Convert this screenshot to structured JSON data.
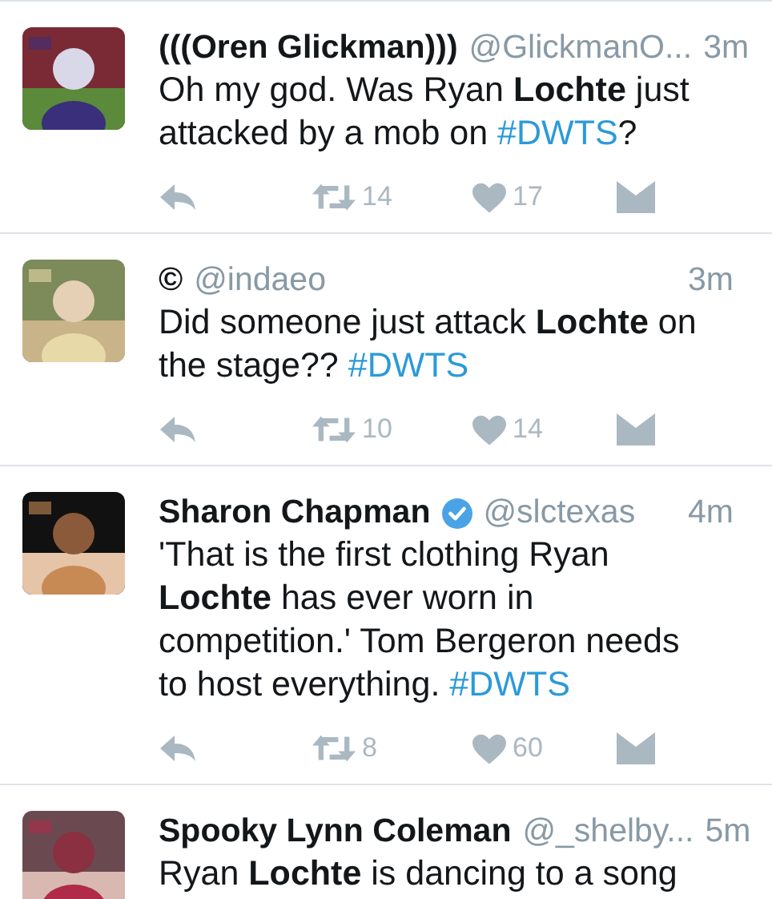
{
  "tweets": [
    {
      "name": "(((Oren Glickman)))",
      "verified": false,
      "handle": "@GlickmanO...",
      "time": "3m",
      "body": [
        {
          "kind": "text",
          "text": "Oh my god. Was Ryan **Lochte** just attacked by a mob on "
        },
        {
          "kind": "hashtag",
          "text": "#DWTS"
        },
        {
          "kind": "text",
          "text": "?"
        }
      ],
      "retweets": "14",
      "likes": "17"
    },
    {
      "name": "©",
      "verified": false,
      "handle": "@indaeo",
      "time": "3m",
      "body": [
        {
          "kind": "text",
          "text": "Did someone just attack **Lochte** on the stage?? "
        },
        {
          "kind": "hashtag",
          "text": "#DWTS"
        }
      ],
      "retweets": "10",
      "likes": "14"
    },
    {
      "name": "Sharon Chapman",
      "verified": true,
      "handle": "@slctexas",
      "time": "4m",
      "body": [
        {
          "kind": "text",
          "text": "'That is the first clothing Ryan **Lochte** has ever worn in competition.' Tom Bergeron needs to host everything. "
        },
        {
          "kind": "hashtag",
          "text": "#DWTS"
        }
      ],
      "retweets": "8",
      "likes": "60"
    },
    {
      "name": "Spooky Lynn Coleman",
      "verified": false,
      "handle": "@_shelby...",
      "time": "5m",
      "body": [
        {
          "kind": "text",
          "text": "Ryan **Lochte** is dancing to a song"
        }
      ]
    }
  ]
}
